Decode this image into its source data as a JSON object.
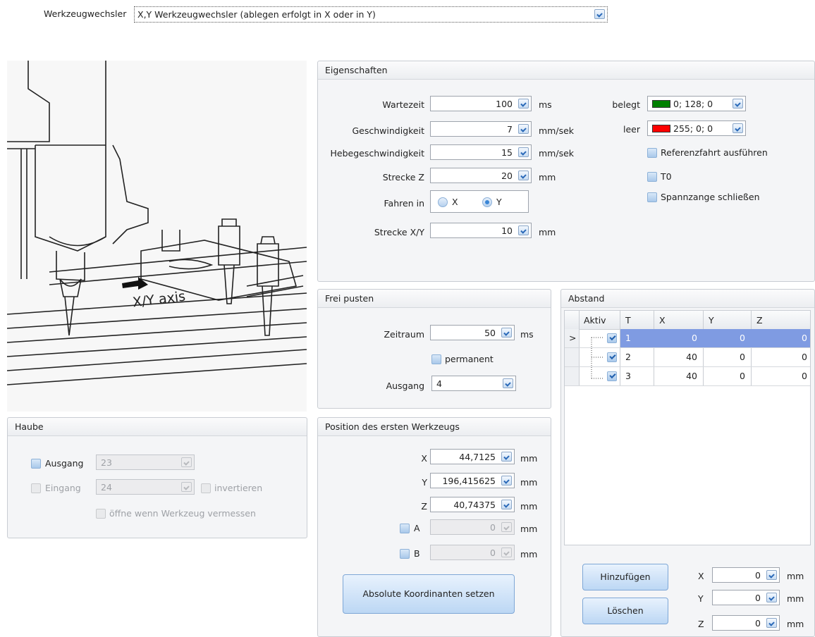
{
  "top": {
    "label": "Werkzeugwechsler",
    "value": "X,Y Werkzeugwechsler (ablegen erfolgt in X oder in Y)"
  },
  "illustration": {
    "caption": "X/Y axis"
  },
  "eigenschaften": {
    "title": "Eigenschaften",
    "wartezeit": {
      "label": "Wartezeit",
      "value": "100",
      "unit": "ms"
    },
    "geschwindigkeit": {
      "label": "Geschwindigkeit",
      "value": "7",
      "unit": "mm/sek"
    },
    "hebegeschwindigkeit": {
      "label": "Hebegeschwindigkeit",
      "value": "15",
      "unit": "mm/sek"
    },
    "strecke_z": {
      "label": "Strecke Z",
      "value": "20",
      "unit": "mm"
    },
    "fahren_in": {
      "label": "Fahren in",
      "opt_x": "X",
      "opt_y": "Y",
      "selected": "Y"
    },
    "strecke_xy": {
      "label": "Strecke X/Y",
      "value": "10",
      "unit": "mm"
    },
    "belegt": {
      "label": "belegt",
      "value": "0; 128; 0",
      "color": "#008000"
    },
    "leer": {
      "label": "leer",
      "value": "255; 0; 0",
      "color": "#ff0000"
    },
    "referenzfahrt": "Referenzfahrt ausführen",
    "t0": "T0",
    "spannzange": "Spannzange schließen"
  },
  "frei_pusten": {
    "title": "Frei pusten",
    "zeitraum": {
      "label": "Zeitraum",
      "value": "50",
      "unit": "ms"
    },
    "permanent": "permanent",
    "ausgang": {
      "label": "Ausgang",
      "value": "4"
    }
  },
  "position": {
    "title": "Position des ersten Werkzeugs",
    "x": {
      "label": "X",
      "value": "44,7125",
      "unit": "mm"
    },
    "y": {
      "label": "Y",
      "value": "196,415625",
      "unit": "mm"
    },
    "z": {
      "label": "Z",
      "value": "40,74375",
      "unit": "mm"
    },
    "a": {
      "label": "A",
      "value": "0",
      "unit": "mm"
    },
    "b": {
      "label": "B",
      "value": "0",
      "unit": "mm"
    },
    "button": "Absolute Koordinanten setzen"
  },
  "haube": {
    "title": "Haube",
    "ausgang": {
      "label": "Ausgang",
      "value": "23"
    },
    "eingang": {
      "label": "Eingang",
      "value": "24"
    },
    "invertieren": "invertieren",
    "oeffne": "öffne wenn Werkzeug vermessen"
  },
  "abstand": {
    "title": "Abstand",
    "columns": [
      "Aktiv",
      "T",
      "X",
      "Y",
      "Z"
    ],
    "rows": [
      {
        "t": "1",
        "x": "0",
        "y": "0",
        "z": "0"
      },
      {
        "t": "2",
        "x": "40",
        "y": "0",
        "z": "0"
      },
      {
        "t": "3",
        "x": "40",
        "y": "0",
        "z": "0"
      }
    ],
    "row_indicator": ">",
    "add_button": "Hinzufügen",
    "delete_button": "Löschen",
    "x": {
      "label": "X",
      "value": "0",
      "unit": "mm"
    },
    "y": {
      "label": "Y",
      "value": "0",
      "unit": "mm"
    },
    "z": {
      "label": "Z",
      "value": "0",
      "unit": "mm"
    }
  }
}
